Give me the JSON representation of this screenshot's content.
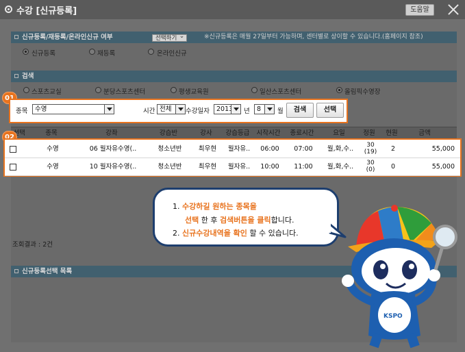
{
  "window": {
    "title": "수강 [신규등록]",
    "help_label": "도움말"
  },
  "reg_section": {
    "heading": "신규등록/재등록/온라인신규 여부",
    "select_button": "선택하기",
    "note": "※신규등록은 매월 27일부터 가능하며, 센터별로 상이할 수 있습니다.(홈페이지 참조)",
    "options": [
      {
        "label": "신규등록",
        "checked": true
      },
      {
        "label": "재등록",
        "checked": false
      },
      {
        "label": "온라인신규",
        "checked": false
      }
    ]
  },
  "search_section": {
    "heading": "검색",
    "centers": [
      {
        "label": "스포츠교실",
        "checked": false
      },
      {
        "label": "분당스포츠센터",
        "checked": false
      },
      {
        "label": "평생교육원",
        "checked": false
      },
      {
        "label": "일산스포츠센터",
        "checked": false
      },
      {
        "label": "올림픽수영장",
        "checked": true
      }
    ],
    "badge_1": "01",
    "badge_2": "02",
    "sport_label": "종목",
    "sport_value": "수영",
    "time_label": "시간",
    "time_value": "전체",
    "date_label": "수강일자",
    "year_value": "2013",
    "year_unit": "년",
    "month_value": "8",
    "month_unit": "월",
    "search_button": "검색",
    "select_button": "선택"
  },
  "table": {
    "headers": [
      "선택",
      "종목",
      "강좌",
      "강습반",
      "강사",
      "강습등급",
      "시작시간",
      "종료시간",
      "요일",
      "정원",
      "현원",
      "금액"
    ],
    "rows": [
      {
        "sport": "수영",
        "course": "06 월자유수영(..",
        "class": "청소년반",
        "teacher": "최우현",
        "grade": "월자유..",
        "start": "06:00",
        "end": "07:00",
        "days": "월,화,수..",
        "capacity": "30",
        "capacity_sub": "(19)",
        "current": "2",
        "price": "55,000"
      },
      {
        "sport": "수영",
        "course": "10 월자유수영(..",
        "class": "청소년반",
        "teacher": "최우현",
        "grade": "월자유..",
        "start": "10:00",
        "end": "11:00",
        "days": "월,화,수..",
        "capacity": "30",
        "capacity_sub": "(0)",
        "current": "0",
        "price": "55,000"
      }
    ],
    "result_count": "조회결과 : 2건"
  },
  "selection_section": {
    "heading": "신규등록선택 목록"
  },
  "tooltip": {
    "line1_num": "1.",
    "line1_hl": "수강하길 원하는 종목을",
    "line2_hl": "선택",
    "line2_mid": "한 후",
    "line2_bold": "검색버튼을 클릭",
    "line2_end": "합니다.",
    "line3_num": "2.",
    "line3_hl": "신규수강내역을 확인",
    "line3_end": "할 수 있습니다."
  },
  "mascot": {
    "logo_text": "KSPO"
  },
  "colors": {
    "accent": "#e8731e",
    "section_header": "#41606f",
    "bubble_border": "#1d3e6e"
  }
}
